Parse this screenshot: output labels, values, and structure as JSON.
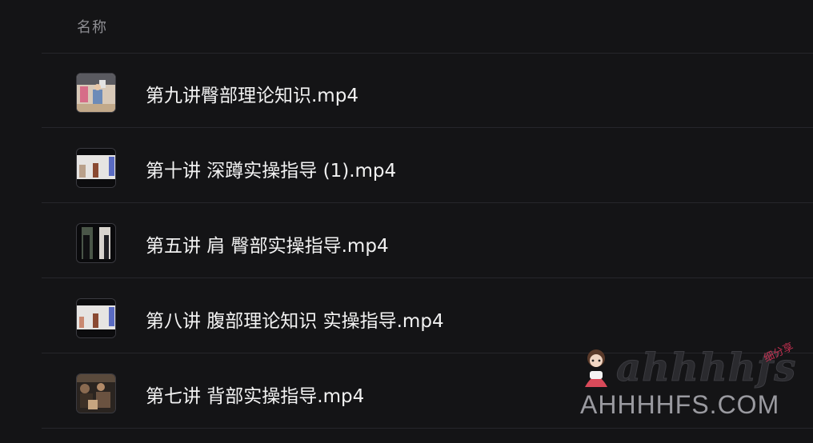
{
  "header": {
    "column_name": "名称"
  },
  "files": [
    {
      "name": "第九讲臀部理论知识.mp4",
      "thumbnail": "video-thumbnail-classroom"
    },
    {
      "name": "第十讲 深蹲实操指导 (1).mp4",
      "thumbnail": "video-thumbnail-lecture"
    },
    {
      "name": "第五讲 肩 臀部实操指导.mp4",
      "thumbnail": "video-thumbnail-dark"
    },
    {
      "name": "第八讲 腹部理论知识 实操指导.mp4",
      "thumbnail": "video-thumbnail-lecture"
    },
    {
      "name": "第七讲 背部实操指导.mp4",
      "thumbnail": "video-thumbnail-group"
    }
  ],
  "watermark": {
    "logo_text": "ahhhhfs",
    "tag_text": "细分享",
    "domain_text": "AHHHHFS.COM"
  },
  "colors": {
    "background": "#141416",
    "divider": "#26262b",
    "filename_text": "#f2f2f2",
    "header_text": "#8d8d92",
    "watermark_accent": "#c13050"
  }
}
